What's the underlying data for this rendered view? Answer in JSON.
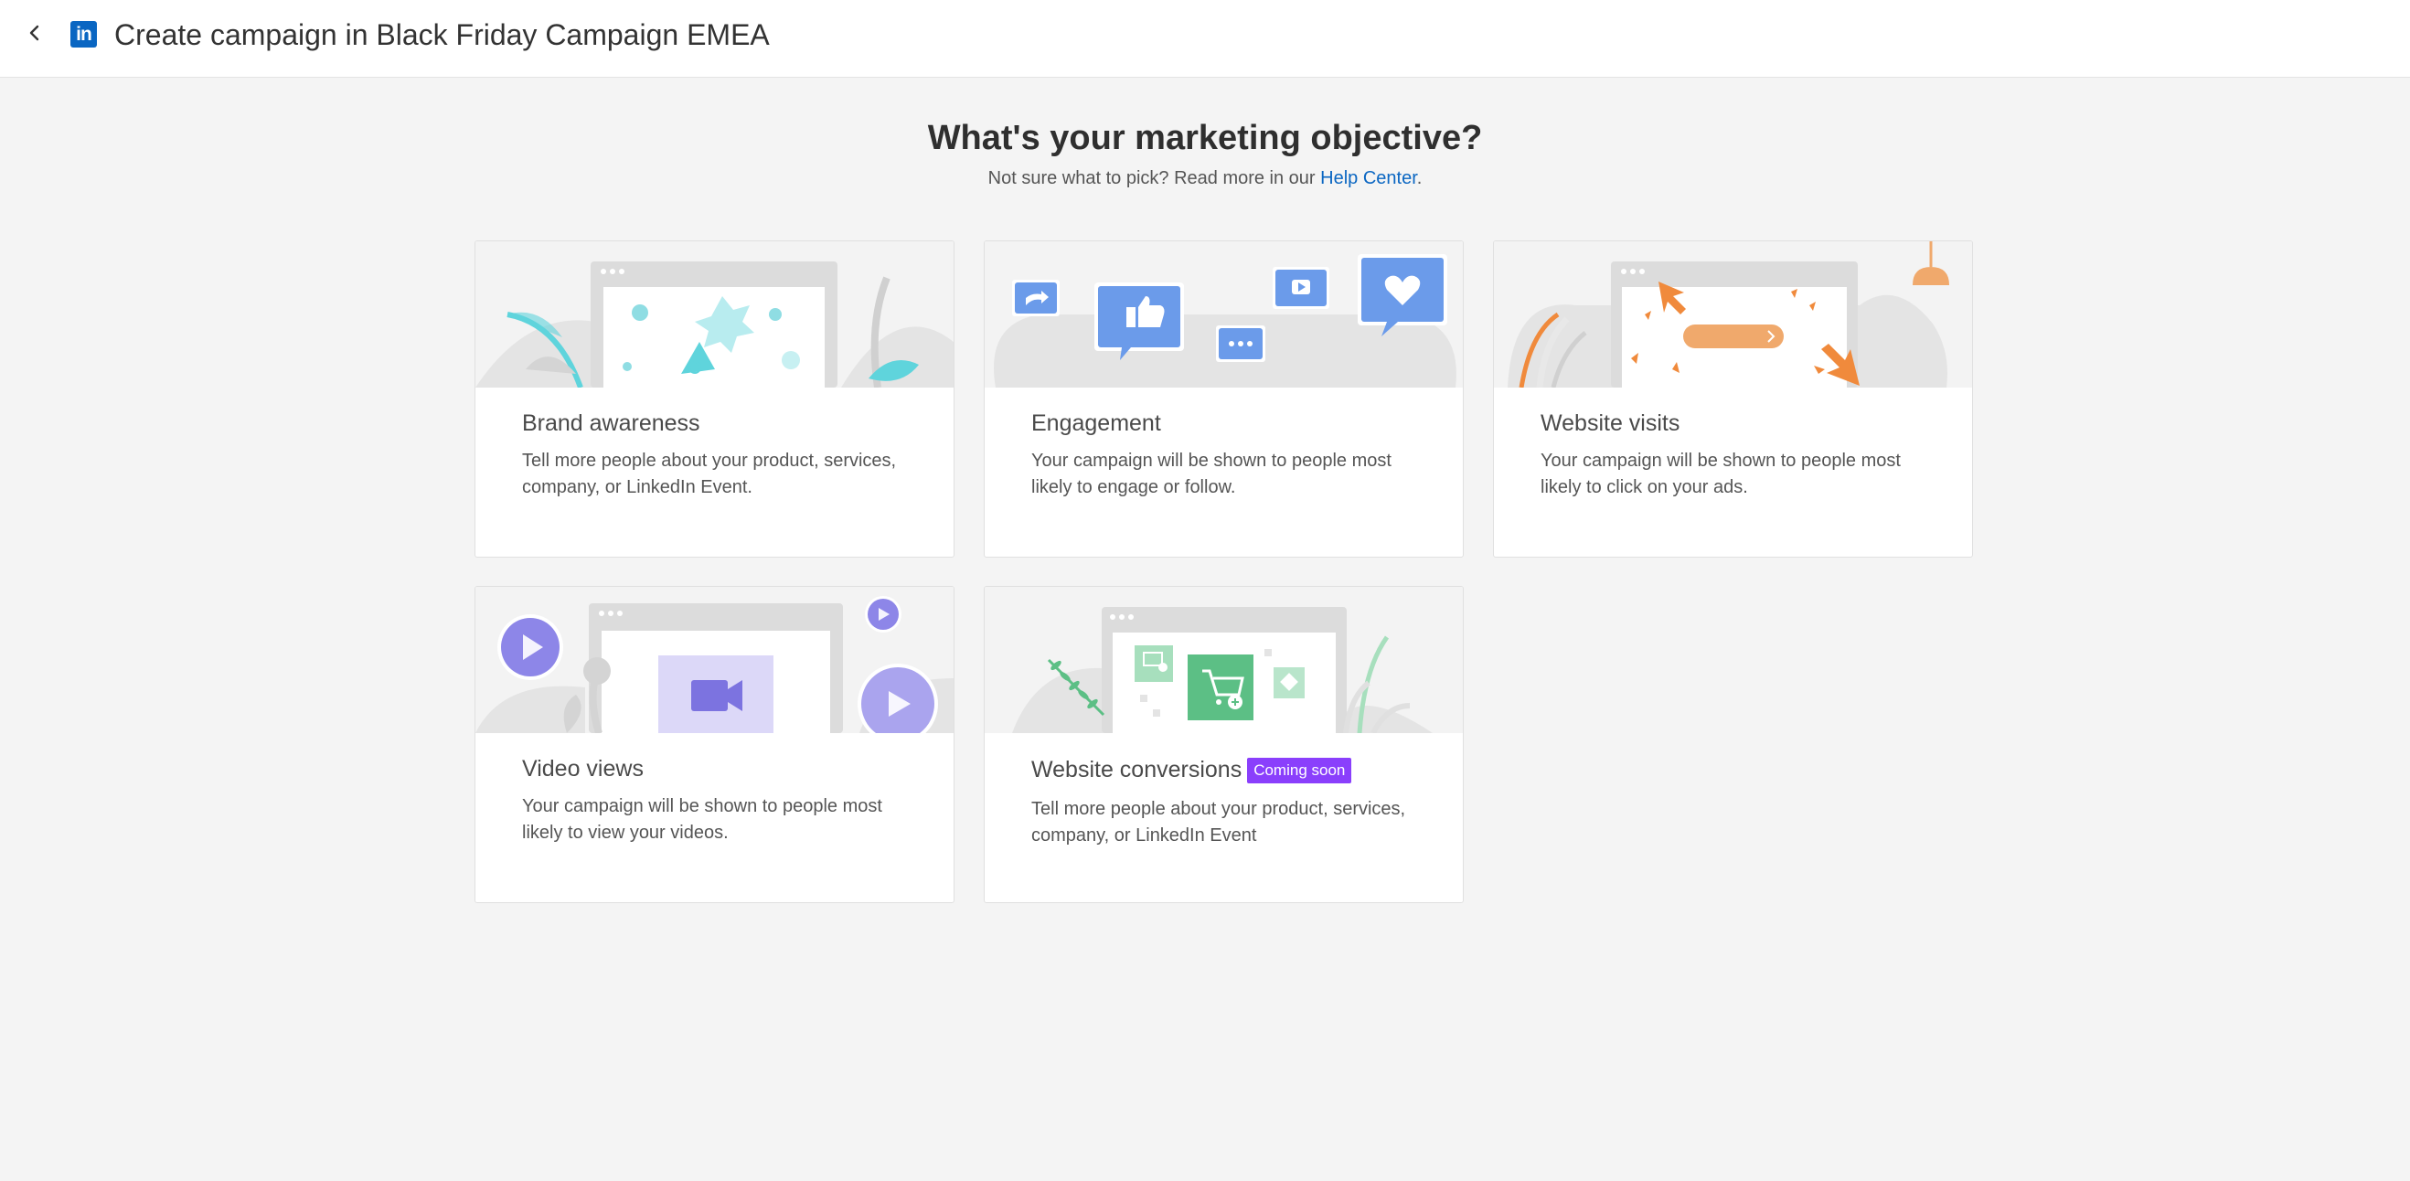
{
  "header": {
    "back_icon": "chevron-left-icon",
    "logo_icon": "linkedin-logo-icon",
    "logo_text": "in",
    "title": "Create campaign in Black Friday Campaign EMEA"
  },
  "main": {
    "headline": "What's your marketing objective?",
    "subline_prefix": "Not sure what to pick? Read more in our ",
    "help_link": "Help Center",
    "subline_suffix": "."
  },
  "objectives": [
    {
      "title": "Brand awareness",
      "description": "Tell more people about your product, services, company, or LinkedIn Event.",
      "illustration": "megaphone-illustration"
    },
    {
      "title": "Engagement",
      "description": "Your campaign will be shown to people most likely to engage or follow.",
      "illustration": "speech-bubbles-illustration"
    },
    {
      "title": "Website visits",
      "description": "Your campaign will be shown to people most likely to click on your ads.",
      "illustration": "cursor-click-illustration"
    },
    {
      "title": "Video views",
      "description": "Your campaign will be shown to people most likely to view your videos.",
      "illustration": "video-camera-illustration"
    },
    {
      "title": "Website conversions",
      "badge": "Coming soon",
      "description": "Tell more people about your product, services, company, or LinkedIn Event",
      "illustration": "shopping-cart-illustration"
    }
  ],
  "colors": {
    "brand": "#0a66c2",
    "badge": "#8a3ffc",
    "background": "#f4f4f4"
  }
}
